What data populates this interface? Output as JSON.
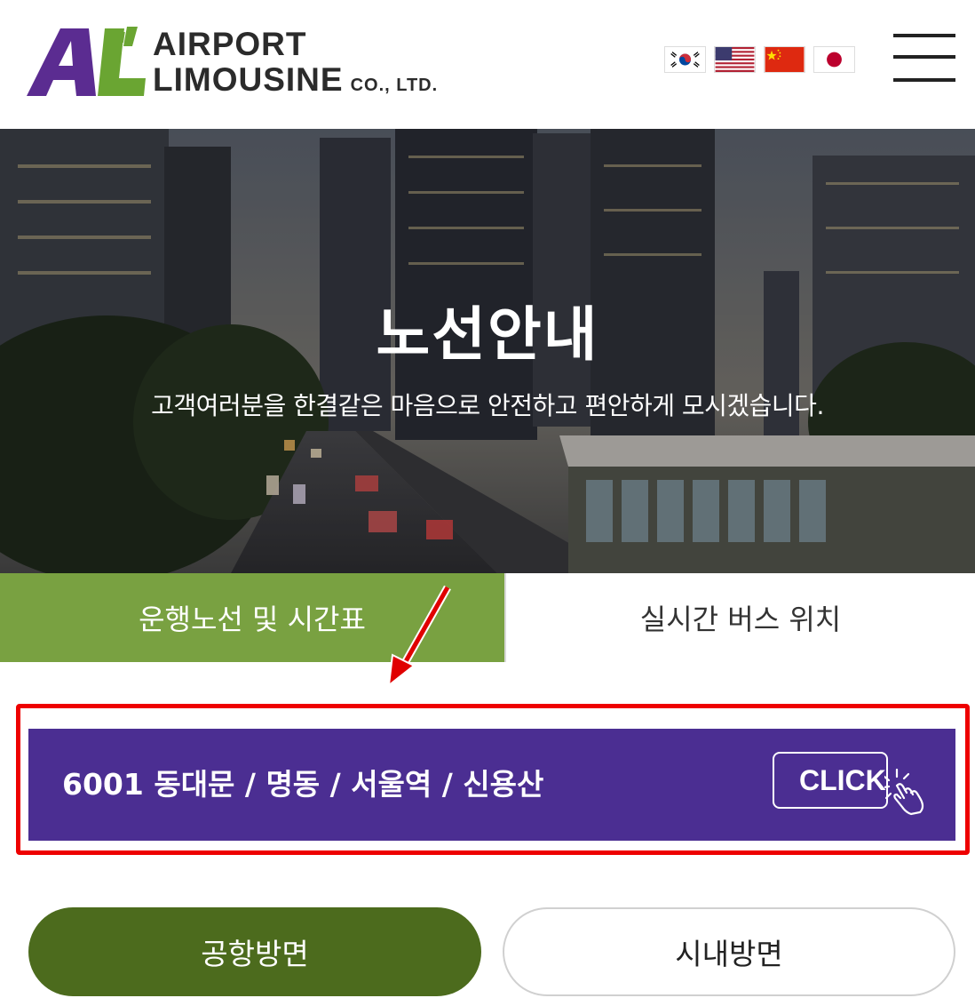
{
  "header": {
    "logo": {
      "mark": "AL",
      "line1": "AIRPORT",
      "line2": "LIMOUSINE",
      "suffix": "CO., LTD."
    },
    "languages": [
      {
        "name": "korean-flag-icon"
      },
      {
        "name": "us-flag-icon"
      },
      {
        "name": "china-flag-icon"
      },
      {
        "name": "japan-flag-icon"
      }
    ],
    "menu_icon": "hamburger-menu-icon"
  },
  "hero": {
    "title": "노선안내",
    "subtitle": "고객여러분을 한결같은 마음으로 안전하고 편안하게 모시겠습니다."
  },
  "tabs": [
    {
      "label": "운행노선 및 시간표",
      "active": true
    },
    {
      "label": "실시간 버스 위치",
      "active": false
    }
  ],
  "route": {
    "label": "6001 동대문 / 명동 / 서울역 / 신용산",
    "click_label": "CLICK"
  },
  "directions": {
    "airport": "공항방면",
    "city": "시내방면"
  },
  "colors": {
    "brand_purple": "#4b2e92",
    "brand_green": "#79a141",
    "dark_green": "#4c6b1d",
    "highlight_red": "#ee0000"
  }
}
